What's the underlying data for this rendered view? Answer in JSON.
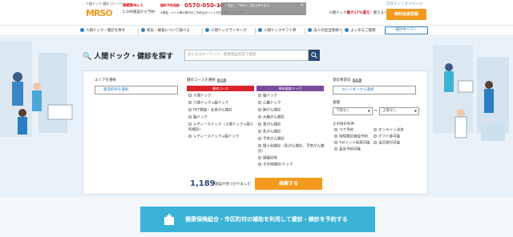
{
  "header": {
    "logo_tag": "人間ドック 健診 (マーソ)",
    "logo_main": "MRSO",
    "badge": "掲載数No.1",
    "count_text": "1,189施設から予約",
    "phone_label": "健診予約相談",
    "phone_number": "0570-050-109",
    "phone_hours": "平日 9:00〜18:00（土日祝休）",
    "phone_note": "※電話・メール等の受付のご予約はポイント付与対象外となります。",
    "tooltip_text": "お電話にて予約のご相談を承ります。",
    "promo_text": "人間ドック",
    "promo_highlight": "最大17%還元",
    "promo_suffix": "！使える！",
    "login": "ログイン",
    "mypage": "マイページ",
    "member_button": "無料会員登録"
  },
  "nav": {
    "items": [
      {
        "label": "人間ドック・健診を探す"
      },
      {
        "label": "病気・検査について調べる"
      },
      {
        "label": "人間ドックランキング"
      },
      {
        "label": "人間ドックギフト券"
      },
      {
        "label": "法人の担当者様へ"
      },
      {
        "label": "よくあるご質問"
      }
    ],
    "history_button": "検討中リスト"
  },
  "search": {
    "title": "人間ドック・健診を探す",
    "placeholder": "気になるキーワード、医療施設名等で検索"
  },
  "panel": {
    "area_label": "エリアを選択",
    "area_button": "都道府県を選択",
    "course_label": "健診コースを選択",
    "course_pill": "複数",
    "general_header": "総合コース",
    "single_header": "単体検査/ドック",
    "general_items": [
      "人間ドック",
      "人間ドック+脳ドック",
      "PET検査・全身がん検診",
      "脳ドック",
      "レディースドック（人間ドック+婦人科検診）",
      "レディースドック+脳ドック"
    ],
    "single_items": [
      "脳ドック",
      "心臓ドック",
      "肺がん検診",
      "大腸がん検診",
      "胃がん検診",
      "乳がん検診",
      "子宮がん検診",
      "婦人科検診（乳がん検診、子宮がん検診）",
      "健康診断",
      "その他検診/ドック"
    ],
    "date_label": "受診希望日",
    "date_pill": "任意",
    "date_button": "カレンダーから選択",
    "price_label": "金額",
    "price_min": "下限なし",
    "price_max": "上限なし",
    "tilde": "〜",
    "other_label": "その他の条件",
    "other_items": [
      "ペア予約",
      "オンライン決済",
      "持続検診施設予約",
      "ギフト券可能",
      "Tポイント利用可能",
      "当日受付可能",
      "直近予約可能"
    ],
    "result_count": "1,189",
    "result_label": "施設が見つかりました",
    "search_button": "検索する"
  },
  "banner": {
    "text": "健康保険組合・市区町村の補助を利用して健診・検診を予約する"
  },
  "colors": {
    "accent": "#f39a1e",
    "brand_blue": "#2a7fc4",
    "navy": "#2a4a72",
    "general_header": "#d8232a",
    "single_header": "#7a4d9b",
    "banner": "#3bb3d6"
  }
}
